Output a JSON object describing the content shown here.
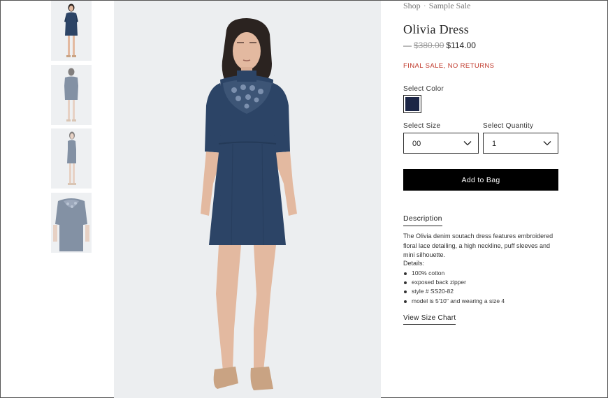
{
  "breadcrumb": {
    "items": [
      "Shop",
      "Sample Sale"
    ],
    "separator": "·"
  },
  "product": {
    "title": "Olivia Dress",
    "price_dash": "—",
    "original_price": "$380.00",
    "sale_price": "$114.00",
    "sale_note": "FINAL SALE, NO RETURNS"
  },
  "color": {
    "label": "Select Color",
    "swatch_hex": "#1c2646"
  },
  "size": {
    "label": "Select Size",
    "value": "00"
  },
  "quantity": {
    "label": "Select Quantity",
    "value": "1"
  },
  "add_to_bag": "Add to Bag",
  "description": {
    "tab_label": "Description",
    "text": "The Olivia denim soutach dress features embroidered floral lace detailing, a high neckline, puff sleeves and mini silhouette.",
    "details_label": "Details:",
    "details": [
      "100% cotton",
      "exposed back zipper",
      "style # SS20-82",
      "model is 5'10\" and wearing a size 4"
    ]
  },
  "size_chart_link": "View Size Chart",
  "gallery": {
    "thumbnail_count": 4,
    "main_image": "model-wearing-denim-dress-photo"
  },
  "colors": {
    "denim": "#2c4466",
    "denim_dark": "#243a58",
    "skin": "#e3b9a0",
    "hair": "#2b2320",
    "background": "#eceef0",
    "sale_red": "#c0392b"
  }
}
